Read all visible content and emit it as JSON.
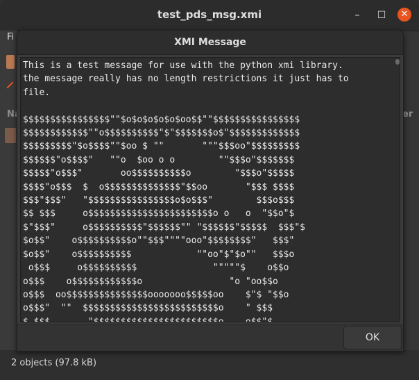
{
  "window": {
    "title": "test_pds_msg.xmi",
    "min_label": "–",
    "max_label": "☐",
    "close_label": "✕"
  },
  "background": {
    "menu_label": "Fi",
    "col_left": "Na",
    "col_right": "er"
  },
  "status": {
    "text": "2 objects (97.8 kB)"
  },
  "dialog": {
    "title": "XMI Message",
    "message": "This is a test message for use with the python xmi library.\nthe message really has no length restrictions it just has to\nfile.\n\n$$$$$$$$$$$$$$$$\"\"$o$o$o$o$o$oo$$\"\"$$$$$$$$$$$$$$$$\n$$$$$$$$$$$$\"\"o$$$$$$$$$$\"$\"$$$$$$$o$\"$$$$$$$$$$$$$\n$$$$$$$$$\"$o$$$$\"\"$oo $ \"\"       \"\"\"$$$oo\"$$$$$$$$$\n$$$$$$\"o$$$$\"   \"\"o  $oo o o        \"\"$$$o\"$$$$$$$\n$$$$$\"o$$$\"       oo$$$$$$$$$$o        \"$$$o\"$$$$$\n$$$$\"o$$$  $  o$$$$$$$$$$$$$$\"$$oo       \"$$$ $$$$\n$$$\"$$$\"   \"$$$$$$$$$$$$$$$$o$o$$$\"        $$$o$$$\n$$ $$$     o$$$$$$$$$$$$$$$$$$$$$$$o o   o  \"$$o\"$\n$\"$$$\"     o$$$$$$$$$$\"$$$$$$\"\" \"$$$$$$\"$$$$$  $$$\"$\n$o$$\"    o$$$$$$$$$$o\"\"$$$\"\"\"\"ooo\"$$$$$$$$\"   $$$\"\n$o$$\"    o$$$$$$$$$$            \"\"oo\"$\"$o\"\"   $$$o\n o$$$     o$$$$$$$$$$              \"\"\"\"\"$    o$$o\no$$$    o$$$$$$$$$$$$o                \"o \"oo$$o\no$$$  oo$$$$$$$$$$$$$$$ooooooo$$$$$oo    $\"$ \"$$o\no$$$\"  \"\"  $$$$$$$$$$$$$$$$$$$$$$$$$o    \" $$$\n$ $$$       \"$$$$$$$$$$$$$$$$$$$$$$$o    o$$\"$\n$$\"$$o       \"$$$$$$$$$$$$$$$$$$$$$$$o   $$$o$"
  },
  "footer": {
    "ok_label": "OK"
  }
}
